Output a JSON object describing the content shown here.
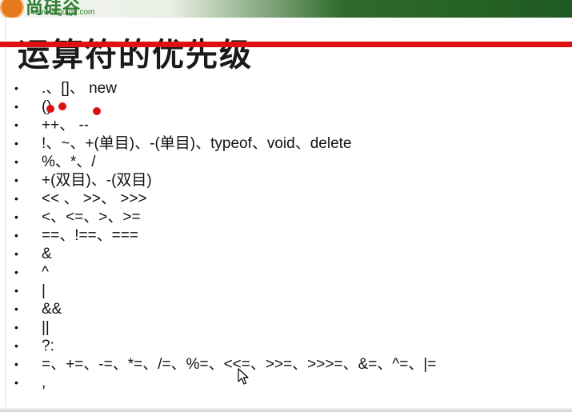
{
  "header": {
    "logo_text": "尚硅谷",
    "logo_url": "www.atguigu.com"
  },
  "slide": {
    "title": "运算符的优先级",
    "bullet_char": "•",
    "items": [
      ".、[]、 new",
      "()",
      "++、 --",
      "!、~、+(单目)、-(单目)、typeof、void、delete",
      "%、*、/",
      "+(双目)、-(双目)",
      "<< 、 >>、 >>>",
      "<、<=、>、>=",
      "==、!==、===",
      "&",
      "^",
      "|",
      "&&",
      "||",
      "?:",
      "=、+=、-=、*=、/=、%=、<<=、>>=、>>>=、&=、^=、|=",
      ","
    ]
  },
  "colors": {
    "accent_red": "#e01010",
    "brand_green": "#2f7d32",
    "annotation_red": "#d11"
  }
}
